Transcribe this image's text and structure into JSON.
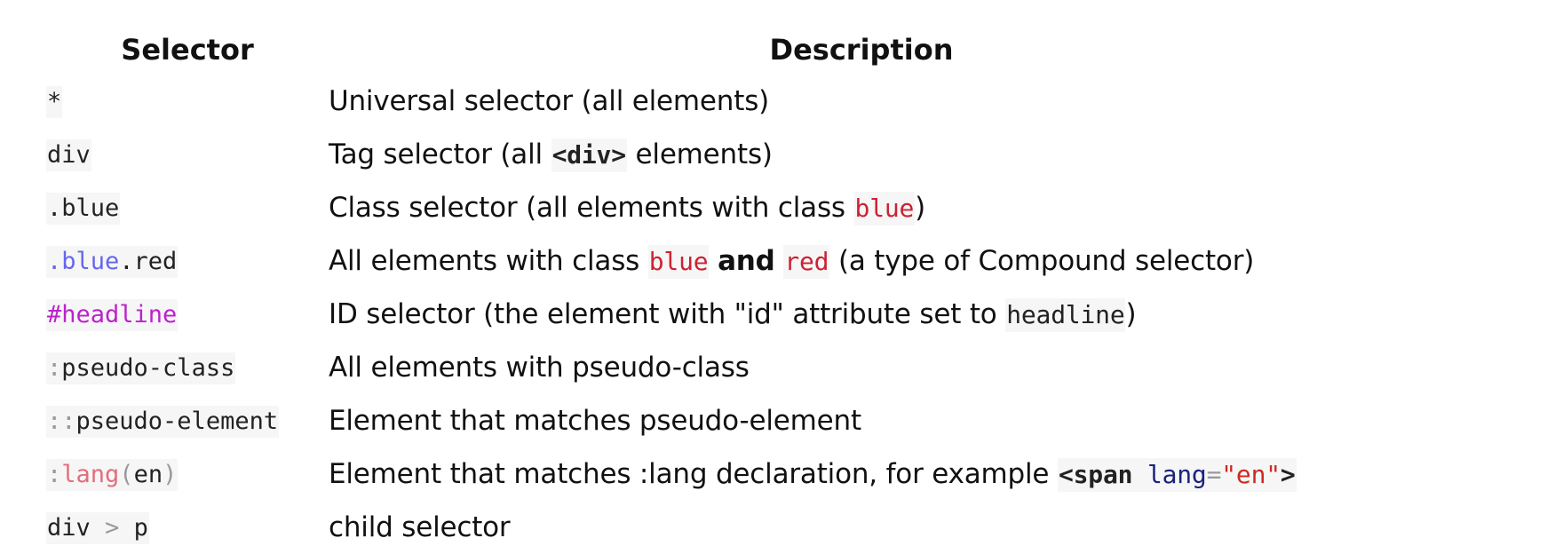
{
  "headers": {
    "selector": "Selector",
    "description": "Description"
  },
  "rows": [
    {
      "selector": [
        "*"
      ],
      "description": [
        "Universal selector (all elements)"
      ]
    },
    {
      "selector": [
        "div"
      ],
      "description": [
        "Tag selector (all ",
        "<div>",
        " elements)"
      ]
    },
    {
      "selector": [
        ".blue"
      ],
      "description": [
        "Class selector (all elements with class ",
        "blue",
        ")"
      ]
    },
    {
      "selector": [
        ".blue",
        ".red"
      ],
      "description": [
        "All elements with class ",
        "blue",
        "and",
        "red",
        "(a type of Compound selector)"
      ]
    },
    {
      "selector": [
        "#headline"
      ],
      "description": [
        "ID selector (the element with \"id\" attribute set to ",
        "headline",
        ")"
      ]
    },
    {
      "selector": [
        ":",
        "pseudo-class"
      ],
      "description": [
        "All elements with pseudo-class"
      ]
    },
    {
      "selector": [
        "::",
        "pseudo-element"
      ],
      "description": [
        "Element that matches pseudo-element"
      ]
    },
    {
      "selector": [
        ":",
        "lang",
        "(",
        "en",
        ")"
      ],
      "description": [
        "Element that matches :lang declaration, for example ",
        "<span",
        "lang",
        "=",
        "\"en\"",
        ">"
      ]
    },
    {
      "selector": [
        "div",
        ">",
        "p"
      ],
      "description": [
        "child selector"
      ]
    }
  ],
  "colors": {
    "class_blue": "#6666ee",
    "id_magenta": "#bb22cc",
    "punct_gray": "#9a9a9a",
    "pseudo_pink": "#e26e7b",
    "keyword_red": "#cc2233",
    "attr_navy": "#1a237e",
    "string_red": "#cc2a22",
    "code_bg": "#f6f6f6"
  }
}
